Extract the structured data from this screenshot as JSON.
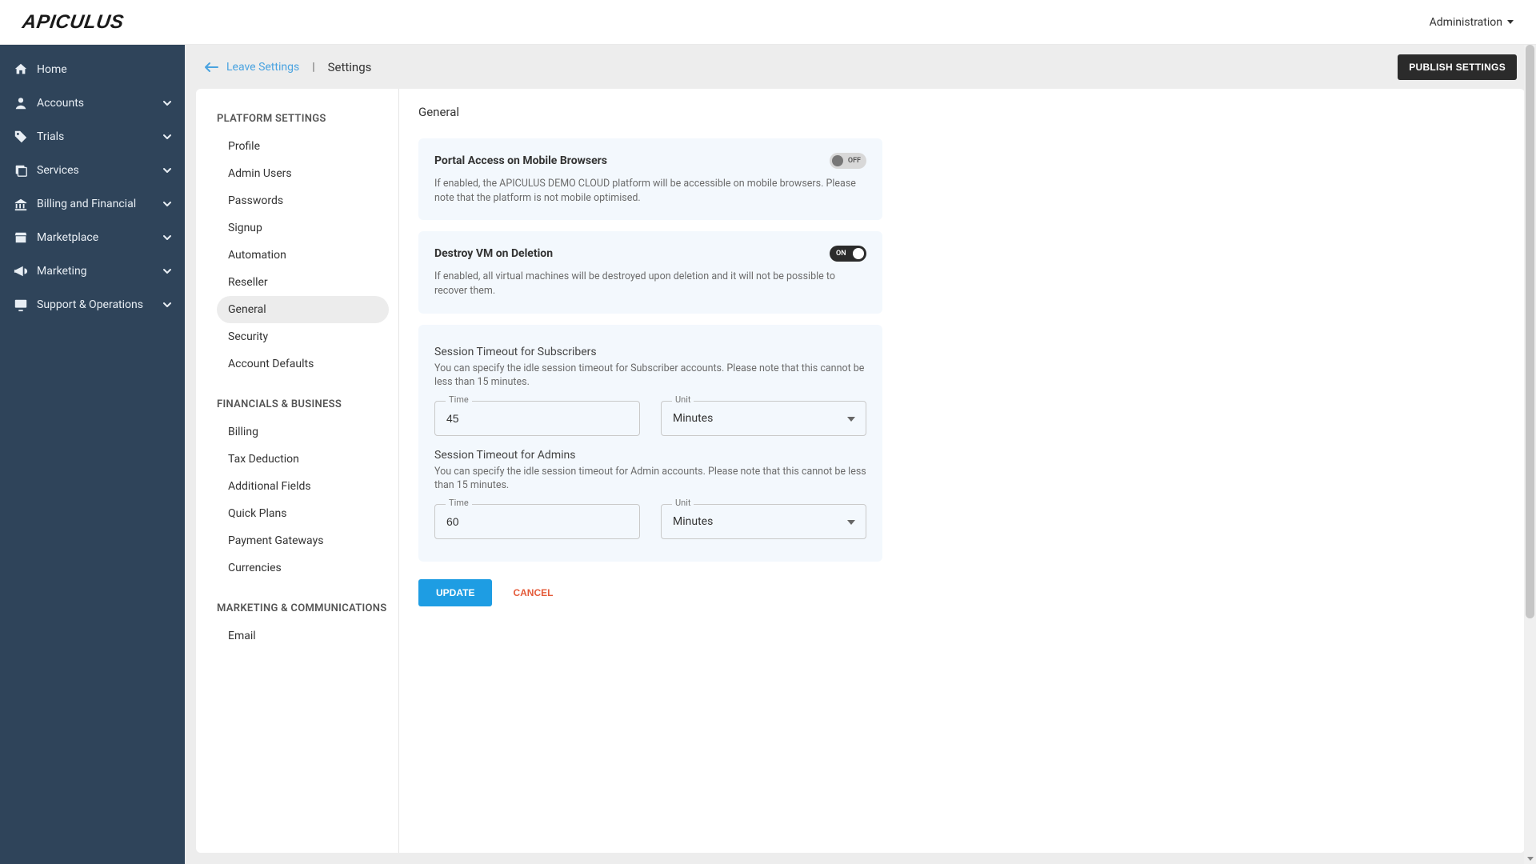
{
  "brand": "APICULUS",
  "top": {
    "admin_label": "Administration"
  },
  "sidebar": {
    "items": [
      {
        "label": "Home",
        "icon": "home",
        "expandable": false
      },
      {
        "label": "Accounts",
        "icon": "account",
        "expandable": true
      },
      {
        "label": "Trials",
        "icon": "tag",
        "expandable": true
      },
      {
        "label": "Services",
        "icon": "layers",
        "expandable": true
      },
      {
        "label": "Billing and Financial",
        "icon": "bank",
        "expandable": true
      },
      {
        "label": "Marketplace",
        "icon": "store",
        "expandable": true
      },
      {
        "label": "Marketing",
        "icon": "megaphone",
        "expandable": true
      },
      {
        "label": "Support & Operations",
        "icon": "monitor",
        "expandable": true
      }
    ]
  },
  "header": {
    "leave_label": "Leave Settings",
    "page_title": "Settings",
    "publish_label": "PUBLISH SETTINGS"
  },
  "settings_nav": {
    "groups": [
      {
        "title": "PLATFORM SETTINGS",
        "items": [
          "Profile",
          "Admin Users",
          "Passwords",
          "Signup",
          "Automation",
          "Reseller",
          "General",
          "Security",
          "Account Defaults"
        ],
        "active_index": 6
      },
      {
        "title": "FINANCIALS & BUSINESS",
        "items": [
          "Billing",
          "Tax Deduction",
          "Additional Fields",
          "Quick Plans",
          "Payment Gateways",
          "Currencies"
        ],
        "active_index": null
      },
      {
        "title": "MARKETING & COMMUNICATIONS",
        "items": [
          "Email"
        ],
        "active_index": null
      }
    ]
  },
  "pane": {
    "title": "General",
    "portal": {
      "title": "Portal Access on Mobile Browsers",
      "state": "OFF",
      "desc": "If enabled, the APICULUS DEMO CLOUD platform will be accessible on mobile browsers. Please note that the platform is not mobile optimised."
    },
    "destroy": {
      "title": "Destroy VM on Deletion",
      "state": "ON",
      "desc": "If enabled, all virtual machines will be destroyed upon deletion and it will not be possible to recover them."
    },
    "sess_sub": {
      "title": "Session Timeout for Subscribers",
      "desc": "You can specify the idle session timeout for Subscriber accounts. Please note that this cannot be less than 15 minutes.",
      "time_label": "Time",
      "time_value": "45",
      "unit_label": "Unit",
      "unit_value": "Minutes"
    },
    "sess_admin": {
      "title": "Session Timeout for Admins",
      "desc": "You can specify the idle session timeout for Admin accounts. Please note that this cannot be less than 15 minutes.",
      "time_label": "Time",
      "time_value": "60",
      "unit_label": "Unit",
      "unit_value": "Minutes"
    },
    "update_label": "UPDATE",
    "cancel_label": "CANCEL"
  }
}
